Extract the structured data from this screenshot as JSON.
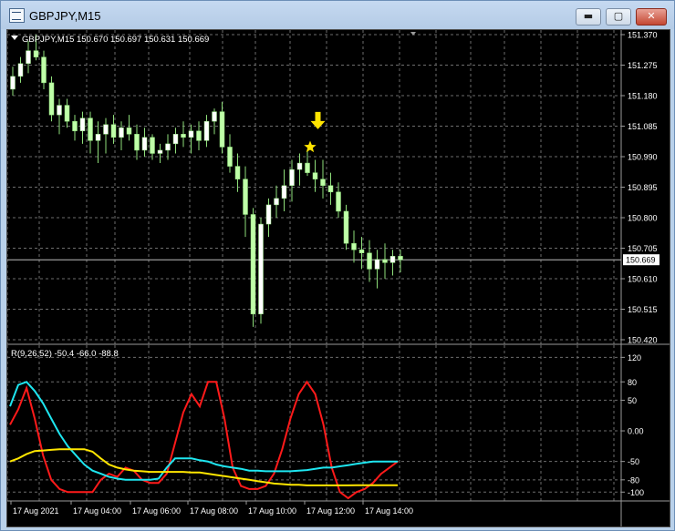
{
  "window": {
    "title": "GBPJPY,M15",
    "buttons": {
      "minimize": "▬",
      "maximize": "▢",
      "close": "✕"
    }
  },
  "chart": {
    "header": "GBPJPY,M15  150.670 150.697 150.631 150.669",
    "price_labels": [
      "151.370",
      "151.275",
      "151.180",
      "151.085",
      "150.990",
      "150.895",
      "150.800",
      "150.705",
      "150.610",
      "150.515",
      "150.420"
    ],
    "current_price": "150.669",
    "time_labels": [
      "17 Aug 2021",
      "17 Aug 04:00",
      "17 Aug 06:00",
      "17 Aug 08:00",
      "17 Aug 10:00",
      "17 Aug 12:00",
      "17 Aug 14:00"
    ]
  },
  "indicator": {
    "header": "R(9,26,52) -50.4 -66.0 -88.8",
    "scale_labels": [
      "120",
      "80",
      "50",
      "0.00",
      "-50",
      "-80",
      "-100"
    ]
  },
  "chart_data": {
    "type": "candlestick",
    "symbol": "GBPJPY",
    "timeframe": "M15",
    "ylim": [
      150.42,
      151.37
    ],
    "current_price": 150.669,
    "arrow_marker": {
      "candle_index": 41,
      "price": 151.05
    },
    "star_marker": {
      "candle_index": 40,
      "price": 151.0
    },
    "colors": {
      "up": "#ffffff",
      "down": "#bfffa8",
      "wick": "#8ede7a",
      "arrow": "#ffe400",
      "grid": "#6d6d6d"
    },
    "candles": [
      [
        151.2,
        151.27,
        151.18,
        151.24
      ],
      [
        151.24,
        151.3,
        151.22,
        151.28
      ],
      [
        151.28,
        151.35,
        151.25,
        151.32
      ],
      [
        151.32,
        151.37,
        151.29,
        151.3
      ],
      [
        151.3,
        151.32,
        151.2,
        151.22
      ],
      [
        151.22,
        151.24,
        151.1,
        151.12
      ],
      [
        151.12,
        151.17,
        151.06,
        151.15
      ],
      [
        151.15,
        151.17,
        151.08,
        151.1
      ],
      [
        151.1,
        151.12,
        151.04,
        151.07
      ],
      [
        151.07,
        151.13,
        151.03,
        151.11
      ],
      [
        151.11,
        151.13,
        151.0,
        151.04
      ],
      [
        151.04,
        151.1,
        150.97,
        151.06
      ],
      [
        151.06,
        151.11,
        151.0,
        151.09
      ],
      [
        151.09,
        151.12,
        151.03,
        151.05
      ],
      [
        151.05,
        151.1,
        151.01,
        151.08
      ],
      [
        151.08,
        151.12,
        151.04,
        151.06
      ],
      [
        151.06,
        151.09,
        150.98,
        151.01
      ],
      [
        151.01,
        151.08,
        150.99,
        151.05
      ],
      [
        151.05,
        151.06,
        150.98,
        151.0
      ],
      [
        151.0,
        151.03,
        150.97,
        151.01
      ],
      [
        151.01,
        151.06,
        150.98,
        151.03
      ],
      [
        151.03,
        151.08,
        151.0,
        151.06
      ],
      [
        151.06,
        151.1,
        151.02,
        151.05
      ],
      [
        151.05,
        151.09,
        151.0,
        151.07
      ],
      [
        151.07,
        151.1,
        151.01,
        151.04
      ],
      [
        151.04,
        151.12,
        151.02,
        151.1
      ],
      [
        151.1,
        151.14,
        151.06,
        151.13
      ],
      [
        151.13,
        151.16,
        151.0,
        151.02
      ],
      [
        151.02,
        151.06,
        150.94,
        150.96
      ],
      [
        150.96,
        151.0,
        150.88,
        150.92
      ],
      [
        150.92,
        150.96,
        150.74,
        150.81
      ],
      [
        150.81,
        150.83,
        150.46,
        150.5
      ],
      [
        150.5,
        150.8,
        150.47,
        150.78
      ],
      [
        150.78,
        150.86,
        150.74,
        150.84
      ],
      [
        150.84,
        150.9,
        150.8,
        150.86
      ],
      [
        150.86,
        150.95,
        150.82,
        150.9
      ],
      [
        150.9,
        150.98,
        150.85,
        150.95
      ],
      [
        150.95,
        151.0,
        150.9,
        150.97
      ],
      [
        150.97,
        151.01,
        150.93,
        150.94
      ],
      [
        150.94,
        150.98,
        150.88,
        150.92
      ],
      [
        150.92,
        150.98,
        150.86,
        150.9
      ],
      [
        150.9,
        150.94,
        150.84,
        150.88
      ],
      [
        150.88,
        150.91,
        150.8,
        150.82
      ],
      [
        150.82,
        150.84,
        150.7,
        150.72
      ],
      [
        150.72,
        150.76,
        150.66,
        150.7
      ],
      [
        150.7,
        150.74,
        150.64,
        150.69
      ],
      [
        150.69,
        150.73,
        150.6,
        150.64
      ],
      [
        150.64,
        150.7,
        150.58,
        150.67
      ],
      [
        150.67,
        150.72,
        150.61,
        150.66
      ],
      [
        150.66,
        150.7,
        150.62,
        150.68
      ],
      [
        150.68,
        150.7,
        150.63,
        150.669
      ]
    ],
    "indicator_series": [
      {
        "color": "#ff1a1a",
        "ylim": [
          -110,
          125
        ],
        "values": [
          10,
          35,
          70,
          20,
          -40,
          -80,
          -95,
          -100,
          -100,
          -100,
          -100,
          -80,
          -70,
          -75,
          -60,
          -65,
          -80,
          -85,
          -85,
          -70,
          -20,
          30,
          60,
          40,
          80,
          80,
          20,
          -60,
          -90,
          -95,
          -95,
          -90,
          -70,
          -30,
          20,
          60,
          80,
          60,
          10,
          -60,
          -100,
          -110,
          -100,
          -95,
          -85,
          -70,
          -60,
          -50
        ]
      },
      {
        "color": "#1ee6f0",
        "ylim": [
          -110,
          125
        ],
        "values": [
          40,
          75,
          80,
          65,
          45,
          20,
          -5,
          -25,
          -40,
          -55,
          -65,
          -70,
          -75,
          -78,
          -80,
          -80,
          -80,
          -80,
          -78,
          -60,
          -45,
          -45,
          -45,
          -48,
          -50,
          -55,
          -58,
          -60,
          -62,
          -65,
          -65,
          -66,
          -66,
          -66,
          -66,
          -65,
          -64,
          -62,
          -60,
          -60,
          -58,
          -56,
          -54,
          -52,
          -50,
          -50,
          -50,
          -50
        ]
      },
      {
        "color": "#ffe600",
        "ylim": [
          -110,
          125
        ],
        "values": [
          -50,
          -45,
          -38,
          -33,
          -32,
          -31,
          -30,
          -30,
          -30,
          -30,
          -34,
          -45,
          -55,
          -60,
          -63,
          -65,
          -66,
          -67,
          -67,
          -67,
          -67,
          -67,
          -68,
          -68,
          -70,
          -72,
          -74,
          -76,
          -78,
          -80,
          -82,
          -84,
          -86,
          -87,
          -88,
          -88,
          -89,
          -89,
          -89,
          -89,
          -89,
          -89,
          -88.8,
          -88.8,
          -88.8,
          -88.8,
          -88.8,
          -88.8
        ]
      }
    ]
  }
}
